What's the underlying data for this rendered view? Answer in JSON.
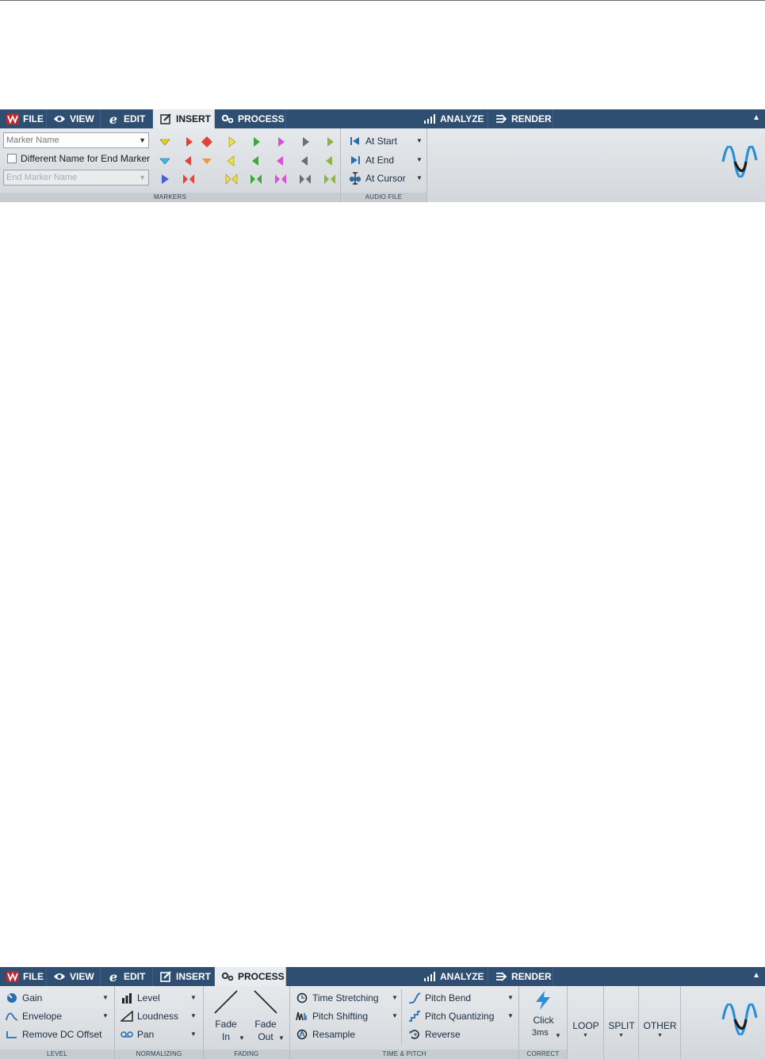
{
  "tabs": {
    "file": "FILE",
    "view": "VIEW",
    "edit": "EDIT",
    "insert": "INSERT",
    "process": "PROCESS",
    "analyze": "ANALYZE",
    "render": "RENDER"
  },
  "insert_ribbon": {
    "active_tab": "INSERT",
    "marker_name_placeholder": "Marker Name",
    "different_name_label": "Different Name for End Marker",
    "different_name_checked": false,
    "end_marker_name_placeholder": "End Marker Name",
    "markers_group": "MARKERS",
    "audio_file_group": "AUDIO FILE",
    "at_start": "At Start",
    "at_end": "At End",
    "at_cursor": "At Cursor",
    "marker_colors": {
      "yellow": "#e8d31e",
      "cyan": "#3fb7e8",
      "blue": "#4a5fd6",
      "red": "#e0433a",
      "orange": "#f19a2f",
      "green": "#3aa83a",
      "magenta": "#d94fd6",
      "gray": "#6b6f74",
      "olive": "#8fb34a"
    }
  },
  "process_ribbon": {
    "active_tab": "PROCESS",
    "gain": "Gain",
    "envelope": "Envelope",
    "remove_dc": "Remove DC Offset",
    "level_group": "LEVEL",
    "level": "Level",
    "loudness": "Loudness",
    "pan": "Pan",
    "normalizing_group": "NORMALIZING",
    "fade_in_1": "Fade",
    "fade_in_2": "In",
    "fade_out_1": "Fade",
    "fade_out_2": "Out",
    "fading_group": "FADING",
    "time_stretching": "Time Stretching",
    "pitch_shifting": "Pitch Shifting",
    "resample": "Resample",
    "pitch_bend": "Pitch Bend",
    "pitch_quantizing": "Pitch Quantizing",
    "reverse": "Reverse",
    "time_pitch_group": "TIME & PITCH",
    "click": "Click",
    "click_value": "3ms",
    "correct_group": "CORRECT",
    "loop": "LOOP",
    "split": "SPLIT",
    "other": "OTHER"
  },
  "colors": {
    "tabbar": "#2e4f72",
    "accent_blue": "#2a6fad",
    "logo_blue": "#2a8fd8"
  }
}
